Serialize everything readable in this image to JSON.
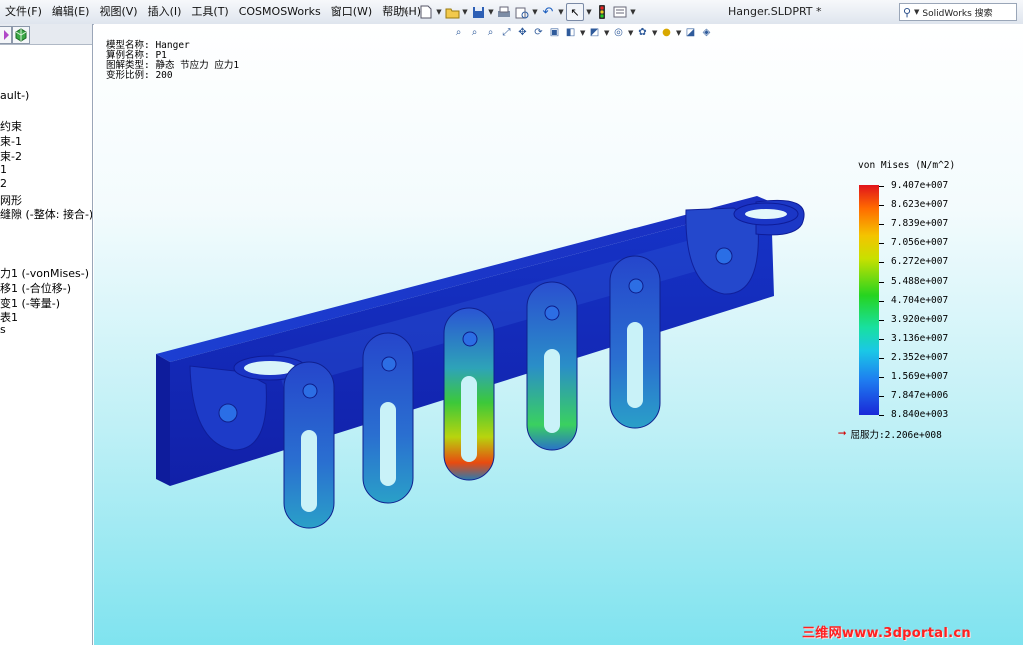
{
  "menu": [
    "文件(F)",
    "编辑(E)",
    "视图(V)",
    "插入(I)",
    "工具(T)",
    "COSMOSWorks",
    "窗口(W)",
    "帮助(H)"
  ],
  "toolbar_icons": [
    "new-icon",
    "open-icon",
    "save-icon",
    "print-icon",
    "undo-icon",
    "select-icon",
    "traffic-light-icon",
    "options-icon"
  ],
  "doc_title": "Hanger.SLDPRT *",
  "search": {
    "placeholder": "SolidWorks 搜索"
  },
  "tree_items": [
    "ault-)",
    "约束",
    "束-1",
    "束-2",
    "1",
    "2",
    "网形",
    "缝隙 (-整体: 接合-)",
    "力1 (-vonMises-)",
    "移1 (-合位移-)",
    "变1 (-等量-)",
    "表1",
    "s"
  ],
  "view_tools": [
    "zoom-fit-icon",
    "zoom-window-icon",
    "zoom-in-icon",
    "zoom-to-selection-icon",
    "pan-icon",
    "rotate-icon",
    "view-orientation-icon",
    "section-view-icon",
    "display-style-icon",
    "hide-show-icon",
    "appearance-icon",
    "scene-icon",
    "realview-icon",
    "shadows-icon"
  ],
  "info": {
    "model_name": "模型名称: Hanger",
    "study_name": "算例名称: P1",
    "plot_type": "图解类型: 静态 节应力 应力1",
    "deform_scale": "变形比例: 200"
  },
  "legend": {
    "title": "von Mises (N/m^2)",
    "labels": [
      "9.407e+007",
      "8.623e+007",
      "7.839e+007",
      "7.056e+007",
      "6.272e+007",
      "5.488e+007",
      "4.704e+007",
      "3.920e+007",
      "3.136e+007",
      "2.352e+007",
      "1.569e+007",
      "7.847e+006",
      "8.840e+003"
    ],
    "yield_text": "屈服力:2.206e+008"
  },
  "watermark": "三维网www.3dportal.cn"
}
